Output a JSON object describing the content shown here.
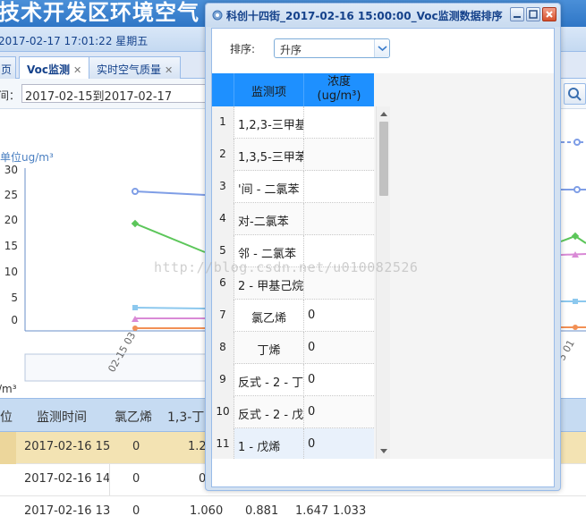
{
  "bg": {
    "title": "技术开发区环境空气",
    "date": "2017-02-17 17:01:22 星期五",
    "tabs": [
      {
        "label": "页"
      },
      {
        "label": "Voc监测"
      },
      {
        "label": "实时空气质量"
      }
    ],
    "range_label": "间：",
    "range_value": "2017-02-15到2017-02-17",
    "chart_unit": "单位ug/m³",
    "y_ticks": [
      "30",
      "25",
      "20",
      "15",
      "10",
      "5",
      "0"
    ],
    "x_labels": [
      "02-15 03",
      "5 01"
    ],
    "unit_below": "/m³",
    "grid_headers": [
      "位",
      "监测时间",
      "氯乙烯",
      "1,3-丁"
    ],
    "grid_rows": [
      [
        "2017-02-16 15",
        "0",
        "1.2"
      ],
      [
        "2017-02-16 14",
        "0",
        "0"
      ],
      [
        "2017-02-16 13",
        "0",
        "1.060",
        "0.881",
        "1.647",
        "1.033"
      ]
    ],
    "colors": {
      "blue_line": "#7f9ee6",
      "green_line": "#5cc65a",
      "cyan_line": "#8cc8ee",
      "pink_line": "#d98ad6",
      "orange_line": "#f29055"
    }
  },
  "modal": {
    "title": "科创十四街_2017-02-16 15:00:00_Voc监测数据排序",
    "sort_label": "排序:",
    "sort_value": "升序",
    "columns": [
      "监测项",
      "浓度(ug/m³)"
    ],
    "rows": [
      {
        "num": "1",
        "name": "1,2,3-三甲基",
        "value": ""
      },
      {
        "num": "2",
        "name": "1,3,5-三甲苯",
        "value": ""
      },
      {
        "num": "3",
        "name": "'间 - 二氯苯",
        "value": ""
      },
      {
        "num": "4",
        "name": "对-二氯苯",
        "value": ""
      },
      {
        "num": "5",
        "name": "邻 - 二氯苯",
        "value": ""
      },
      {
        "num": "6",
        "name": "2 - 甲基己烷",
        "value": ""
      },
      {
        "num": "7",
        "name": "氯乙烯",
        "value": "0"
      },
      {
        "num": "8",
        "name": "丁烯",
        "value": "0"
      },
      {
        "num": "9",
        "name": "反式 - 2 - 丁",
        "value": "0"
      },
      {
        "num": "10",
        "name": "反式 - 2 - 戊",
        "value": "0"
      },
      {
        "num": "11",
        "name": "1 - 戊烯",
        "value": "0"
      }
    ],
    "header_color": "#1e90ff"
  },
  "watermark": "http://blog.csdn.net/u010082526"
}
